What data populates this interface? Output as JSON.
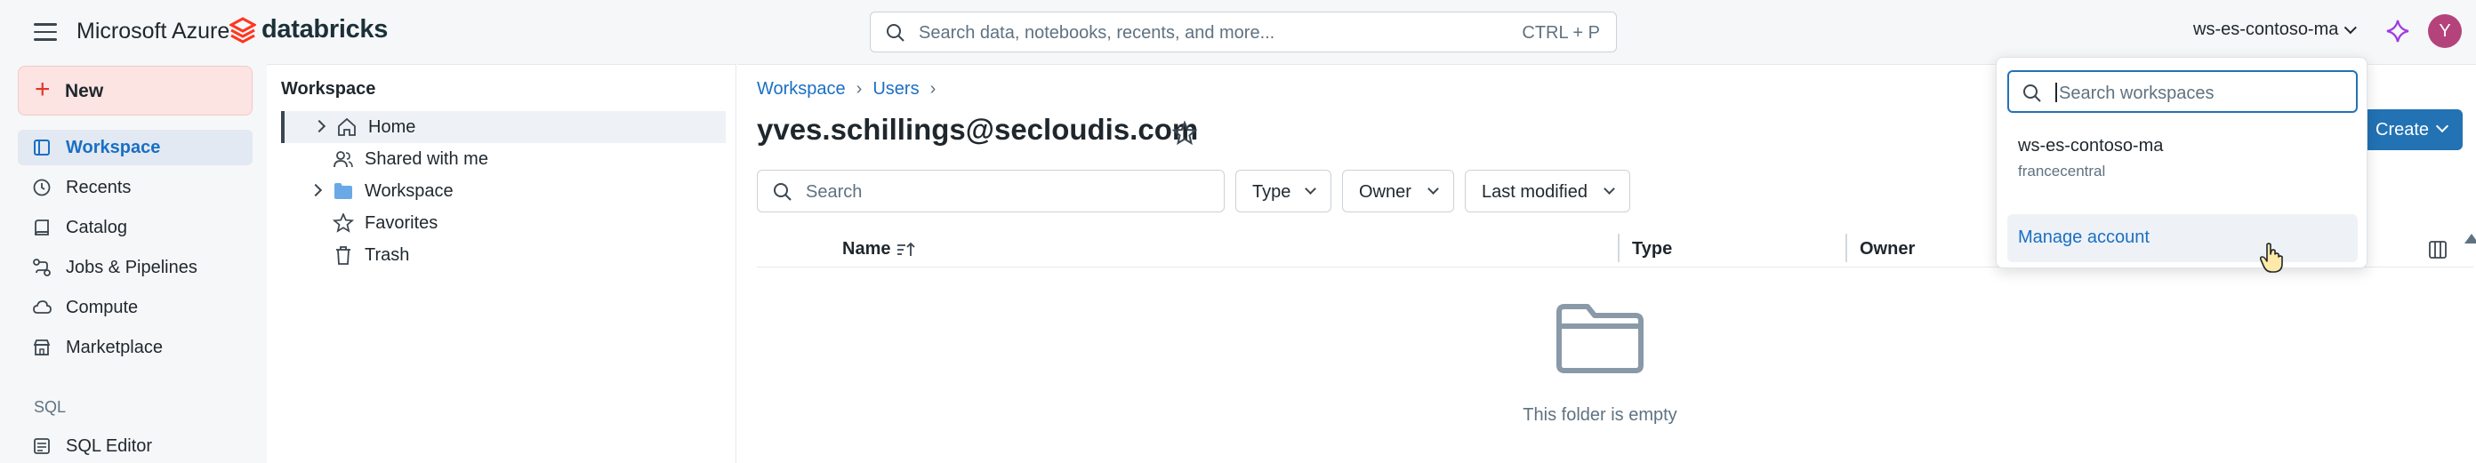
{
  "topbar": {
    "menu_icon": "hamburger-icon",
    "brand_ms": "Microsoft Azure",
    "brand_db": "databricks",
    "search_placeholder": "Search data, notebooks, recents, and more...",
    "search_shortcut": "CTRL + P",
    "workspace_name": "ws-es-contoso-ma",
    "avatar_initial": "Y",
    "accent_color": "#2272b4",
    "avatar_color": "#b4437c"
  },
  "sidebar": {
    "new_label": "New",
    "items": [
      {
        "label": "Workspace",
        "icon": "folder-outline-icon",
        "active": true
      },
      {
        "label": "Recents",
        "icon": "clock-icon"
      },
      {
        "label": "Catalog",
        "icon": "catalog-icon"
      },
      {
        "label": "Jobs & Pipelines",
        "icon": "workflow-icon"
      },
      {
        "label": "Compute",
        "icon": "cloud-icon"
      },
      {
        "label": "Marketplace",
        "icon": "store-icon"
      }
    ],
    "section_sql": "SQL",
    "sql_items": [
      {
        "label": "SQL Editor",
        "icon": "sql-editor-icon"
      }
    ]
  },
  "tree": {
    "title": "Workspace",
    "items": [
      {
        "label": "Home",
        "icon": "home-icon",
        "expandable": true,
        "selected": true
      },
      {
        "label": "Shared with me",
        "icon": "users-icon",
        "expandable": false
      },
      {
        "label": "Workspace",
        "icon": "folder-icon",
        "expandable": true
      },
      {
        "label": "Favorites",
        "icon": "star-icon",
        "expandable": false
      },
      {
        "label": "Trash",
        "icon": "trash-icon",
        "expandable": false
      }
    ]
  },
  "main": {
    "breadcrumbs": [
      "Workspace",
      "Users"
    ],
    "title": "yves.schillings@secloudis.com",
    "create_label": "Create",
    "search_placeholder": "Search",
    "filters": [
      "Type",
      "Owner",
      "Last modified"
    ],
    "columns": [
      "Name",
      "Type",
      "Owner"
    ],
    "empty_message": "This folder is empty"
  },
  "dropdown": {
    "search_placeholder": "Search workspaces",
    "workspace_name": "ws-es-contoso-ma",
    "workspace_region": "francecentral",
    "manage_label": "Manage account"
  }
}
